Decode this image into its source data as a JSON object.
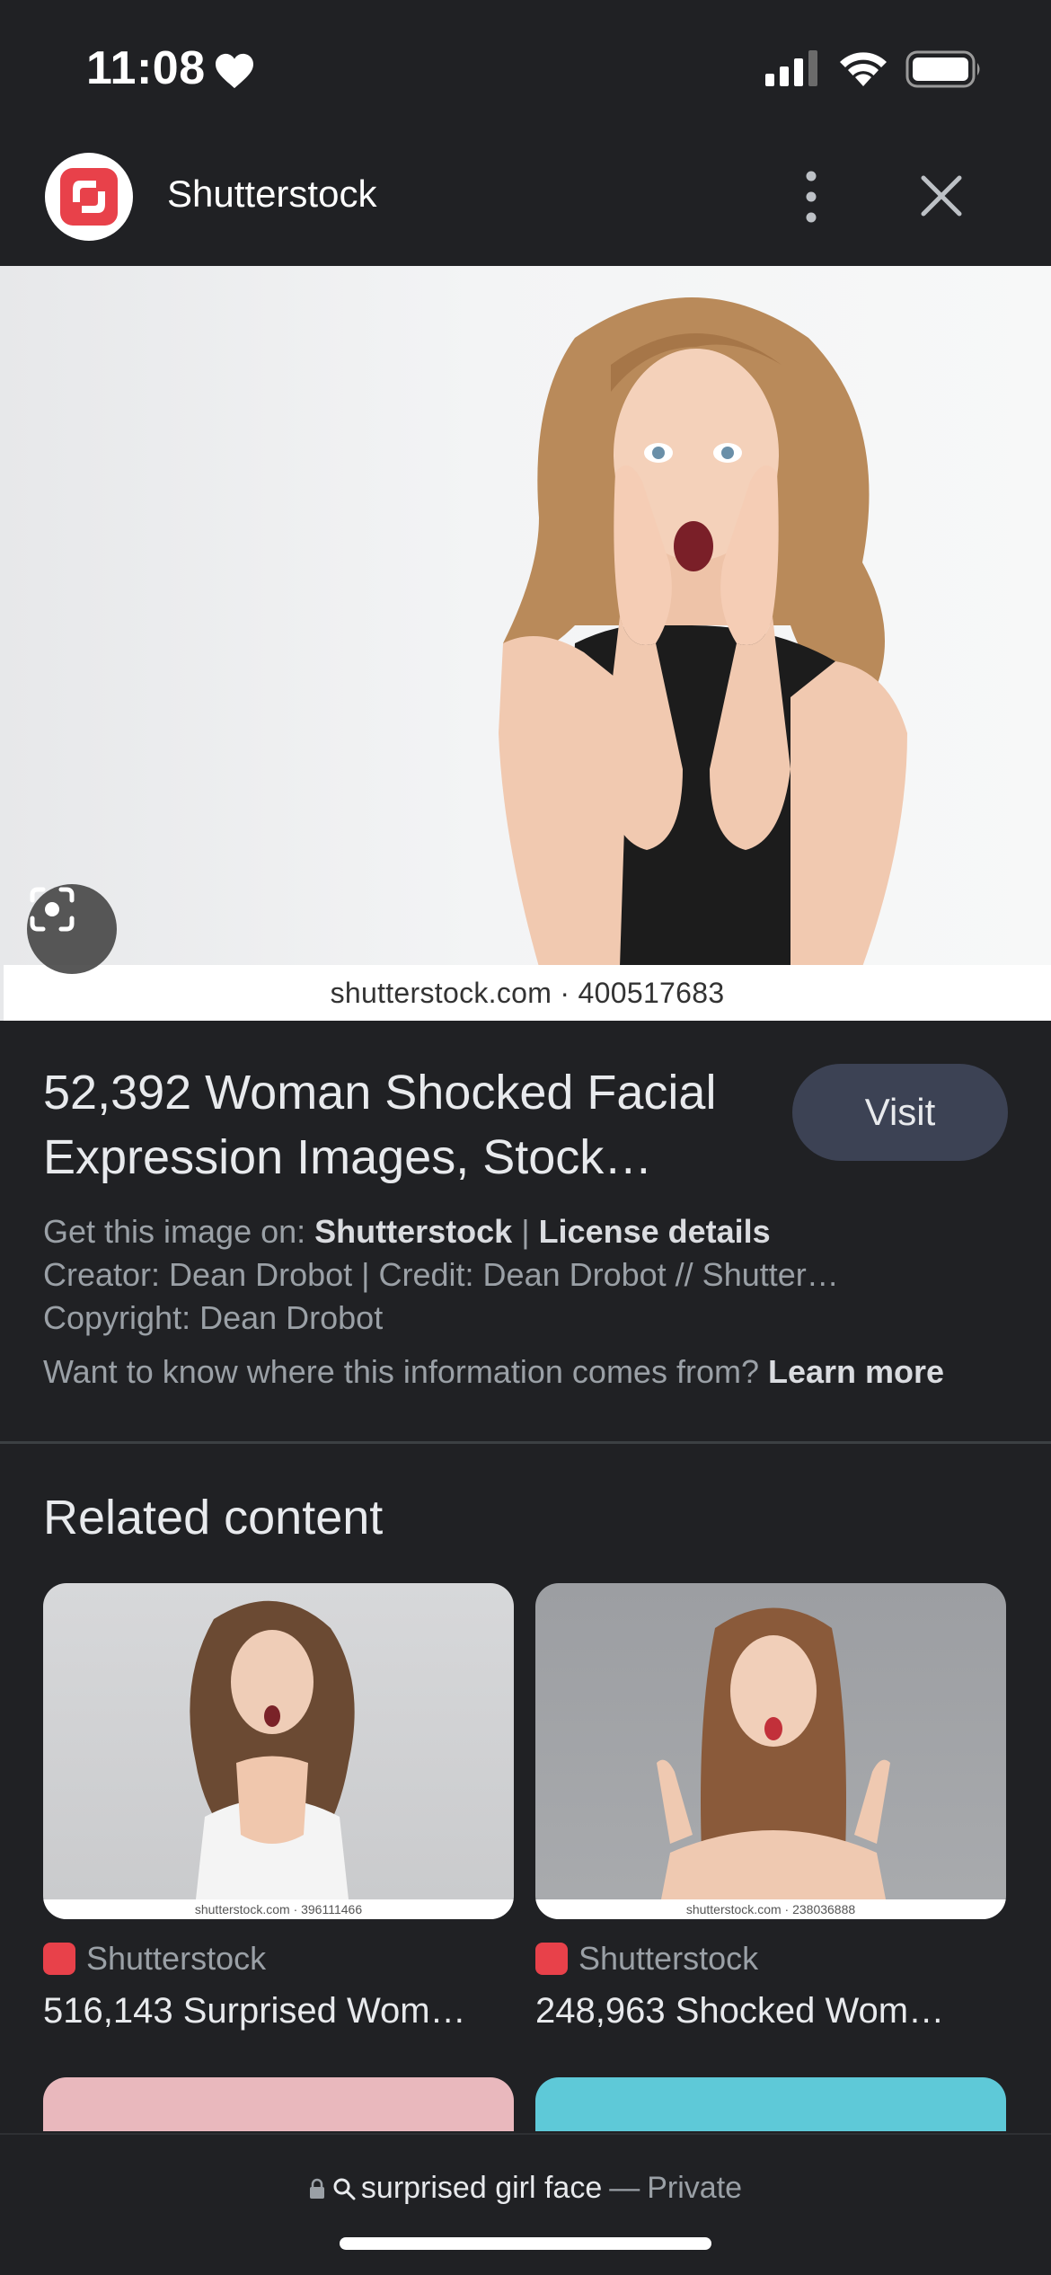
{
  "status_bar": {
    "time": "11:08"
  },
  "header": {
    "site_name": "Shutterstock"
  },
  "main_image": {
    "watermark": "shutterstock.com · 400517683"
  },
  "result": {
    "title": "52,392 Woman Shocked Facial Expression Images, Stock…",
    "visit_label": "Visit",
    "get_image_prefix": "Get this image on: ",
    "get_image_source": "Shutterstock",
    "pipe": " | ",
    "license_label": "License details",
    "creator_line": "Creator: Dean Drobot | Credit: Dean Drobot // Shutter…",
    "copyright_line": "Copyright: Dean Drobot",
    "info_question": "Want to know where this information comes from? ",
    "learn_more": "Learn more"
  },
  "related": {
    "heading": "Related content",
    "items": [
      {
        "source": "Shutterstock",
        "title": "516,143 Surprised Wom…",
        "watermark": "shutterstock.com · 396111466"
      },
      {
        "source": "Shutterstock",
        "title": "248,963 Shocked Wom…",
        "watermark": "shutterstock.com · 238036888"
      }
    ]
  },
  "bottom_bar": {
    "query": "surprised girl face",
    "separator": "—",
    "mode": "Private"
  },
  "colors": {
    "background": "#202124",
    "brand": "#e8414a",
    "visit_button": "#3c4254"
  }
}
